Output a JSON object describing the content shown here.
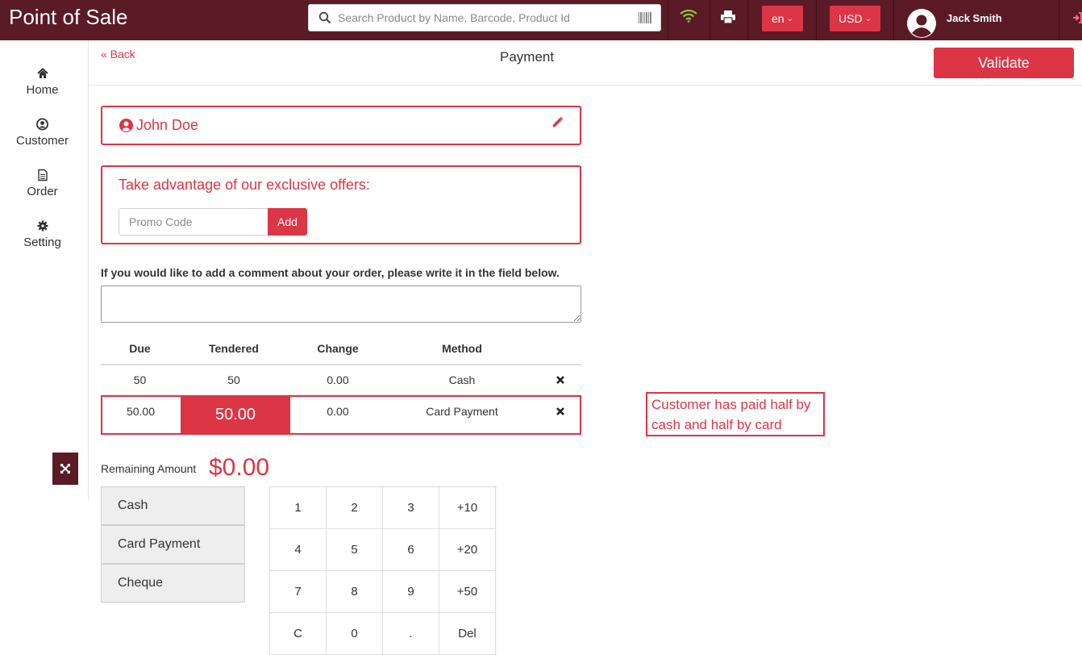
{
  "topbar": {
    "app_title": "Point of Sale",
    "search_placeholder": "Search Product by Name, Barcode, Product Id",
    "language": "en",
    "currency": "USD",
    "user_name": "Jack Smith"
  },
  "sidebar": {
    "items": [
      {
        "label": "Home",
        "icon": "home-icon"
      },
      {
        "label": "Customer",
        "icon": "user-circle-icon"
      },
      {
        "label": "Order",
        "icon": "document-icon"
      },
      {
        "label": "Setting",
        "icon": "gear-icon"
      }
    ]
  },
  "header": {
    "back_label": "« Back",
    "title": "Payment",
    "validate_label": "Validate"
  },
  "customer": {
    "name": "John Doe"
  },
  "offer": {
    "title": "Take advantage of our exclusive offers:",
    "promo_placeholder": "Promo Code",
    "add_label": "Add"
  },
  "comment": {
    "label": "If you would like to add a comment about your order, please write it in the field below.",
    "value": ""
  },
  "payment_table": {
    "headers": [
      "Due",
      "Tendered",
      "Change",
      "Method"
    ],
    "rows": [
      {
        "due": "50",
        "tendered": "50",
        "change": "0.00",
        "method": "Cash"
      },
      {
        "due": "50.00",
        "tendered": "50.00",
        "change": "0.00",
        "method": "Card Payment"
      }
    ]
  },
  "annotation": {
    "text": "Customer has paid half by cash and half by card"
  },
  "remaining": {
    "label": "Remaining Amount",
    "value": "$0.00"
  },
  "payment_methods": [
    "Cash",
    "Card Payment",
    "Cheque"
  ],
  "numpad": [
    "1",
    "2",
    "3",
    "+10",
    "4",
    "5",
    "6",
    "+20",
    "7",
    "8",
    "9",
    "+50",
    "C",
    "0",
    ".",
    "Del"
  ],
  "colors": {
    "topbar": "#5a1a26",
    "accent": "#dc3545"
  }
}
